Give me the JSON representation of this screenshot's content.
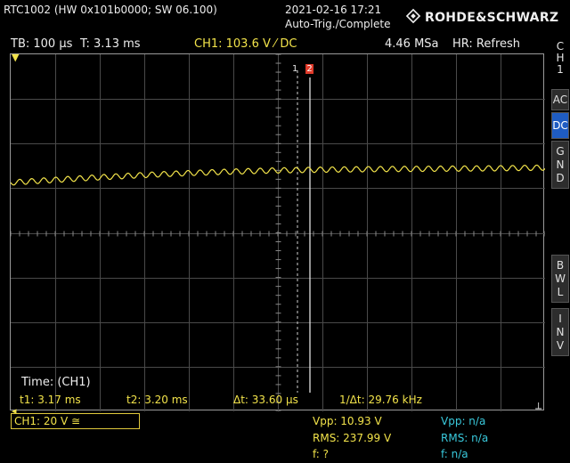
{
  "header": {
    "device": "RTC1002 (HW 0x101b0000; SW 06.100)",
    "datetime": "2021-02-16 17:21",
    "trigger_status": "Auto-Trig./Complete",
    "brand": "ROHDE&SCHWARZ"
  },
  "status_bar": {
    "timebase": "TB: 100 µs",
    "trigger_time": "T: 3.13 ms",
    "channel_setting": "CH1: 103.6 V ⁄ DC",
    "sample_rate": "4.46 MSa",
    "acquisition": "HR: Refresh"
  },
  "cursors": {
    "cursor1_label": "1",
    "cursor2_label": "2"
  },
  "cursor_measurement": {
    "title": "Time: (CH1)",
    "t1": "t1: 3.17 ms",
    "t2": "t2: 3.20 ms",
    "delta_t": "Δt: 33.60 µs",
    "inv_delta_t": "1/Δt: 29.76 kHz"
  },
  "side_menu": {
    "channel": [
      "C",
      "H",
      "1"
    ],
    "ac": "AC",
    "dc": "DC",
    "gnd": [
      "G",
      "N",
      "D"
    ],
    "bwl": [
      "B",
      "W",
      "L"
    ],
    "inv": [
      "I",
      "N",
      "V"
    ]
  },
  "bottom": {
    "channel_badge": "CH1: 20 V ≅",
    "meas1": {
      "vpp": "Vpp: 10.93 V",
      "rms": "RMS: 237.99 V",
      "f": "f: ?"
    },
    "meas2": {
      "vpp": "Vpp: n/a",
      "rms": "RMS: n/a",
      "f": "f: n/a"
    }
  },
  "colors": {
    "channel1": "#f2e34a",
    "cursor2": "#e03a2a",
    "active_tab": "#1f5cc2",
    "measurement2": "#39c9dc"
  },
  "icons": {
    "brand_logo": "rs-diamond-icon",
    "trigger_position": "trigger-position-icon",
    "trigger_level": "trigger-level-icon",
    "ground_marker": "ground-marker-icon"
  }
}
